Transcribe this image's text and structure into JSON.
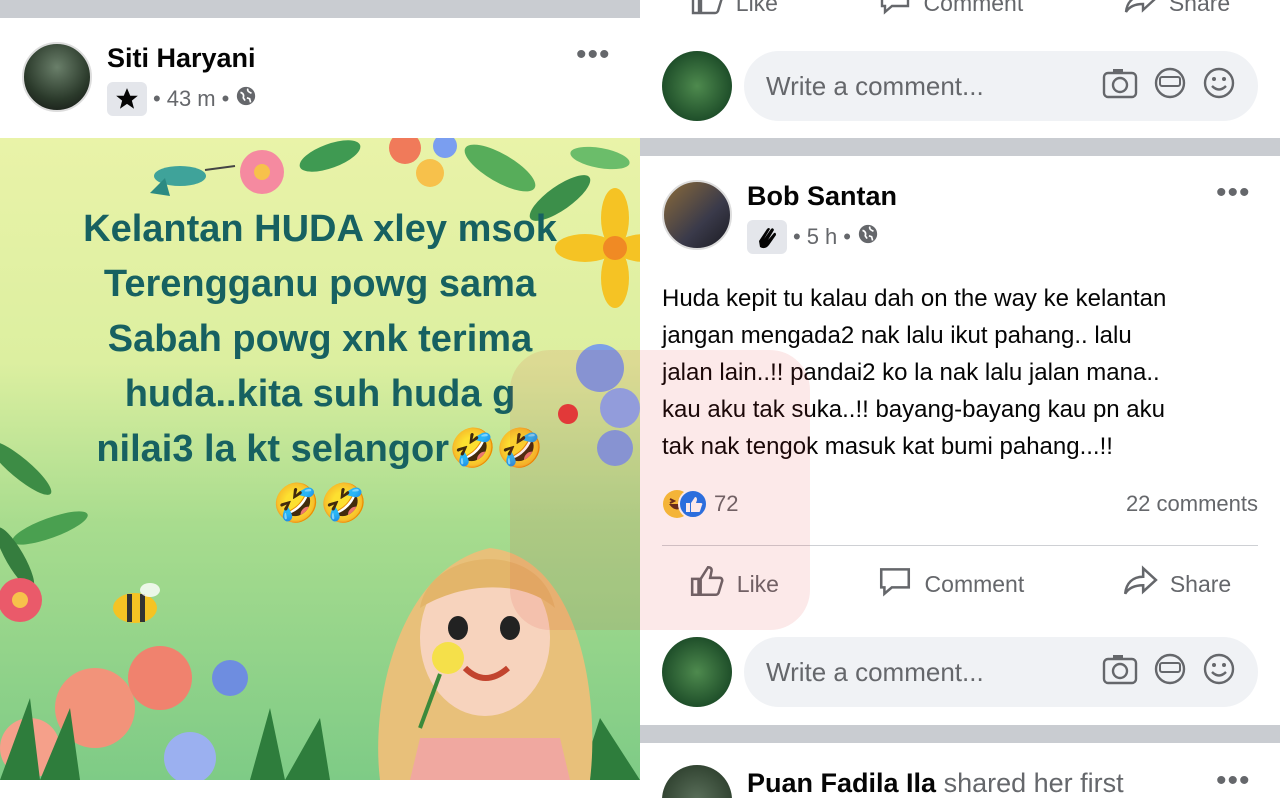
{
  "left_post": {
    "author": "Siti Haryani",
    "time": "43 m",
    "dot": "•",
    "more": "•••",
    "image_text": [
      "Kelantan HUDA xley msok",
      "Terengganu powg sama",
      "Sabah powg xnk terima",
      "huda..kita suh huda g",
      "nilai3 la kt selangor🤣🤣",
      "🤣🤣"
    ]
  },
  "right_top": {
    "actions": {
      "like": "Like",
      "comment": "Comment",
      "share": "Share"
    },
    "comment_placeholder": "Write a comment..."
  },
  "right_post": {
    "author": "Bob Santan",
    "time": "5 h",
    "dot": "•",
    "more": "•••",
    "body": [
      "Huda kepit tu kalau dah on the way ke kelantan",
      "jangan mengada2 nak lalu ikut pahang..  lalu",
      "jalan lain..!! pandai2 ko la nak lalu jalan mana..",
      "kau aku tak suka..!! bayang-bayang kau pn aku",
      "tak nak tengok masuk kat bumi pahang...!!"
    ],
    "reaction_count": "72",
    "comments_count": "22 comments",
    "actions": {
      "like": "Like",
      "comment": "Comment",
      "share": "Share"
    },
    "comment_placeholder": "Write a comment..."
  },
  "next_post": {
    "author": "Puan Fadila Ila",
    "activity": "shared her first",
    "more": "•••"
  },
  "colors": {
    "text_primary": "#050505",
    "text_secondary": "#65676b",
    "separator": "#c9ccd1",
    "comment_bg": "#f0f2f5",
    "image_text": "#176161",
    "like_blue": "#1877f2"
  },
  "icons": [
    "star-icon",
    "globe-icon",
    "wave-icon",
    "like-icon",
    "comment-icon",
    "share-icon",
    "camera-icon",
    "gif-icon",
    "smiley-icon",
    "more-icon",
    "haha-reaction-icon",
    "like-reaction-icon"
  ]
}
